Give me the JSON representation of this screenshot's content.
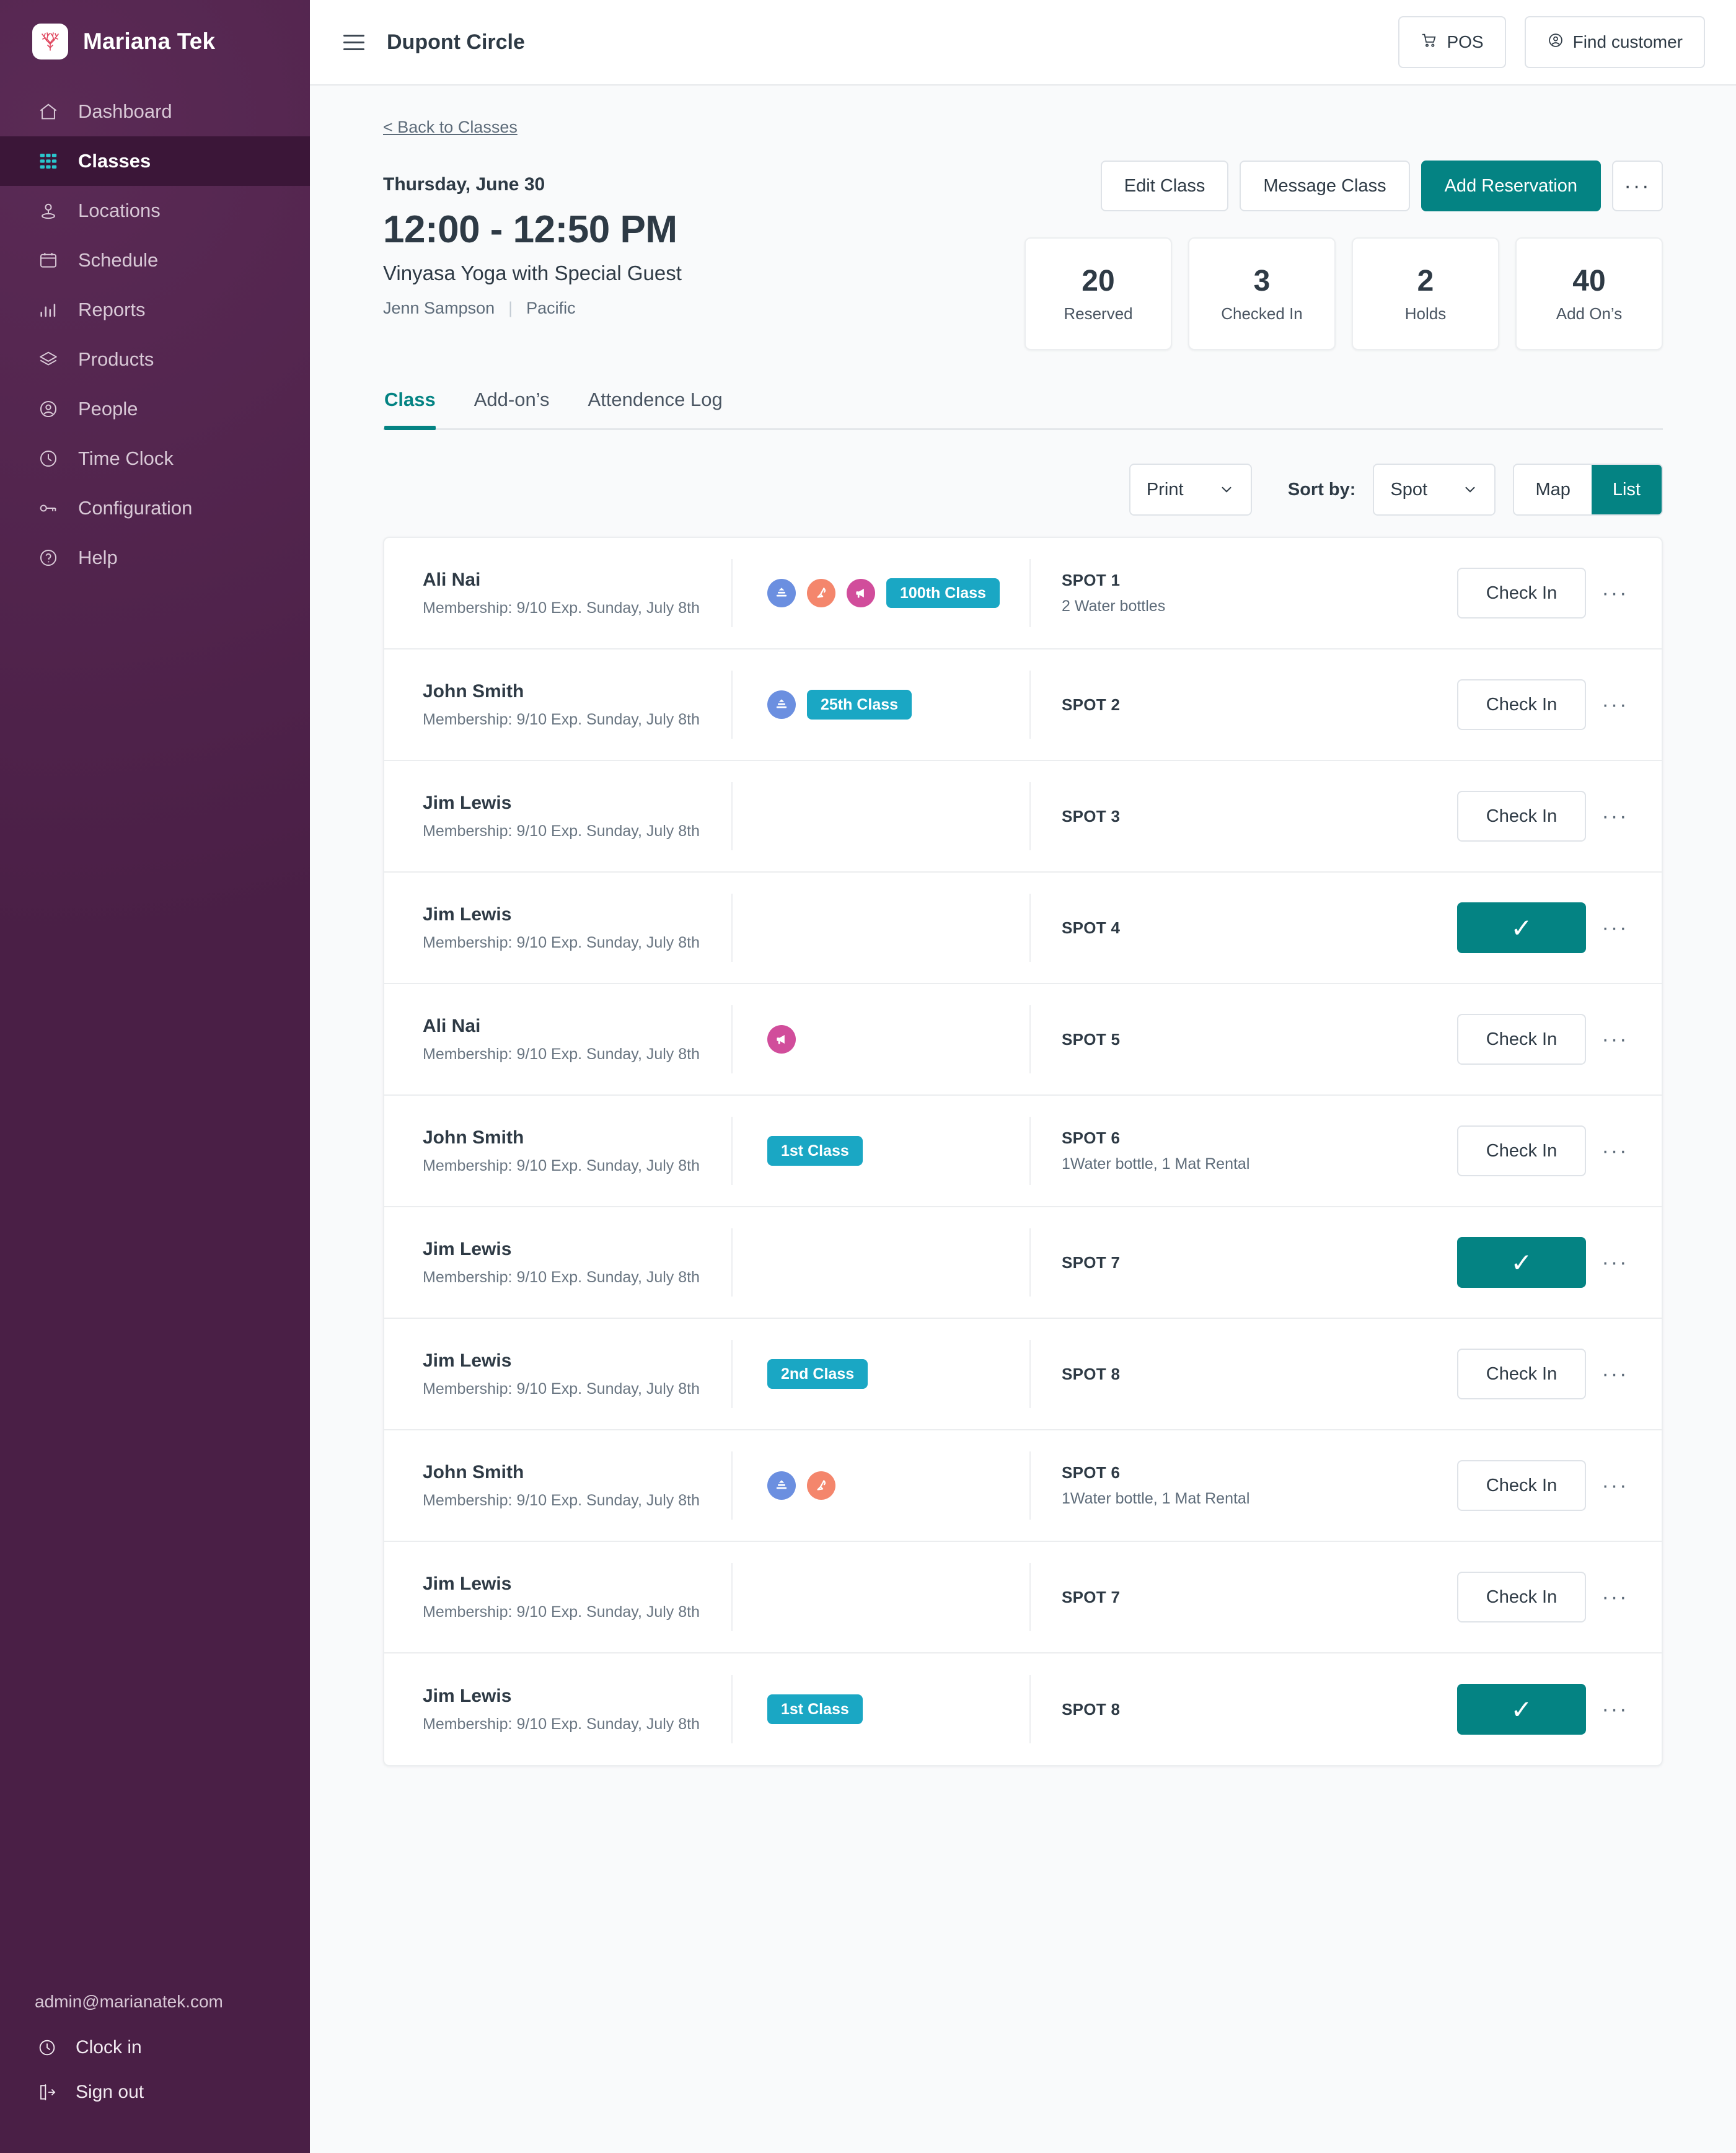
{
  "sidebar": {
    "brand": "Mariana Tek",
    "logo_icon": "coral-logo-icon",
    "items": [
      {
        "label": "Dashboard",
        "icon": "home-icon",
        "active": false
      },
      {
        "label": "Classes",
        "icon": "grid-icon",
        "active": true
      },
      {
        "label": "Locations",
        "icon": "map-pin-icon",
        "active": false
      },
      {
        "label": "Schedule",
        "icon": "calendar-icon",
        "active": false
      },
      {
        "label": "Reports",
        "icon": "bar-chart-icon",
        "active": false
      },
      {
        "label": "Products",
        "icon": "layers-icon",
        "active": false
      },
      {
        "label": "People",
        "icon": "user-circle-icon",
        "active": false
      },
      {
        "label": "Time Clock",
        "icon": "clock-icon",
        "active": false
      },
      {
        "label": "Configuration",
        "icon": "key-icon",
        "active": false
      },
      {
        "label": "Help",
        "icon": "question-icon",
        "active": false
      }
    ],
    "footer": {
      "email": "admin@marianatek.com",
      "clock_in": "Clock in",
      "sign_out": "Sign out"
    }
  },
  "topbar": {
    "title": "Dupont Circle",
    "pos_label": "POS",
    "find_customer_label": "Find customer"
  },
  "page": {
    "back_link": "< Back to Classes",
    "date": "Thursday, June 30",
    "time": "12:00 - 12:50 PM",
    "class_name": "Vinyasa Yoga with Special Guest",
    "instructor": "Jenn Sampson",
    "region": "Pacific",
    "actions": {
      "edit_class": "Edit Class",
      "message_class": "Message Class",
      "add_reservation": "Add Reservation",
      "more": "···"
    },
    "stats": [
      {
        "value": "20",
        "label": "Reserved"
      },
      {
        "value": "3",
        "label": "Checked In"
      },
      {
        "value": "2",
        "label": "Holds"
      },
      {
        "value": "40",
        "label": "Add On’s"
      }
    ],
    "tabs": [
      {
        "label": "Class",
        "active": true
      },
      {
        "label": "Add-on’s",
        "active": false
      },
      {
        "label": "Attendence Log",
        "active": false
      }
    ],
    "toolbar": {
      "print_label": "Print",
      "sort_by_label": "Sort by:",
      "sort_value": "Spot",
      "view_map": "Map",
      "view_list": "List",
      "view_active": "List"
    }
  },
  "roster": {
    "checkin_label": "Check In",
    "checked_glyph": "✓",
    "kebab": "···",
    "rows": [
      {
        "name": "Ali Nai",
        "membership": "Membership: 9/10 Exp. Sunday, July 8th",
        "icons": [
          "layers",
          "pen",
          "megaphone"
        ],
        "chip": "100th Class",
        "spot": "SPOT 1",
        "spot_detail": "2 Water bottles",
        "checked_in": false
      },
      {
        "name": "John Smith",
        "membership": "Membership: 9/10 Exp. Sunday, July 8th",
        "icons": [
          "layers"
        ],
        "chip": "25th Class",
        "spot": "SPOT 2",
        "spot_detail": "",
        "checked_in": false
      },
      {
        "name": "Jim Lewis",
        "membership": "Membership: 9/10 Exp. Sunday, July 8th",
        "icons": [],
        "chip": "",
        "spot": "SPOT 3",
        "spot_detail": "",
        "checked_in": false
      },
      {
        "name": "Jim Lewis",
        "membership": "Membership: 9/10 Exp. Sunday, July 8th",
        "icons": [],
        "chip": "",
        "spot": "SPOT 4",
        "spot_detail": "",
        "checked_in": true
      },
      {
        "name": "Ali Nai",
        "membership": "Membership: 9/10 Exp. Sunday, July 8th",
        "icons": [
          "megaphone"
        ],
        "chip": "",
        "spot": "SPOT 5",
        "spot_detail": "",
        "checked_in": false
      },
      {
        "name": "John Smith",
        "membership": "Membership: 9/10 Exp. Sunday, July 8th",
        "icons": [],
        "chip": "1st Class",
        "spot": "SPOT 6",
        "spot_detail": "1Water bottle, 1 Mat Rental",
        "checked_in": false
      },
      {
        "name": "Jim Lewis",
        "membership": "Membership: 9/10 Exp. Sunday, July 8th",
        "icons": [],
        "chip": "",
        "spot": "SPOT 7",
        "spot_detail": "",
        "checked_in": true
      },
      {
        "name": "Jim Lewis",
        "membership": "Membership: 9/10 Exp. Sunday, July 8th",
        "icons": [],
        "chip": "2nd Class",
        "spot": "SPOT 8",
        "spot_detail": "",
        "checked_in": false
      },
      {
        "name": "John Smith",
        "membership": "Membership: 9/10 Exp. Sunday, July 8th",
        "icons": [
          "layers",
          "pen"
        ],
        "chip": "",
        "spot": "SPOT 6",
        "spot_detail": "1Water bottle, 1 Mat Rental",
        "checked_in": false
      },
      {
        "name": "Jim Lewis",
        "membership": "Membership: 9/10 Exp. Sunday, July 8th",
        "icons": [],
        "chip": "",
        "spot": "SPOT 7",
        "spot_detail": "",
        "checked_in": false
      },
      {
        "name": "Jim Lewis",
        "membership": "Membership: 9/10 Exp. Sunday, July 8th",
        "icons": [],
        "chip": "1st Class",
        "spot": "SPOT 8",
        "spot_detail": "",
        "checked_in": true
      }
    ]
  },
  "colors": {
    "sidebar_bg": "#4a1f46",
    "sidebar_active_bg": "#3b1638",
    "accent_teal": "#048383",
    "chip_blue": "#1aa7c4",
    "icon_blue": "#6b8fe0",
    "icon_orange": "#f4866c",
    "icon_pink": "#d14d9b",
    "logo_red": "#e0475f",
    "text_dark": "#2e3a45",
    "text_muted": "#5d6b79",
    "page_bg": "#f9fafb"
  }
}
